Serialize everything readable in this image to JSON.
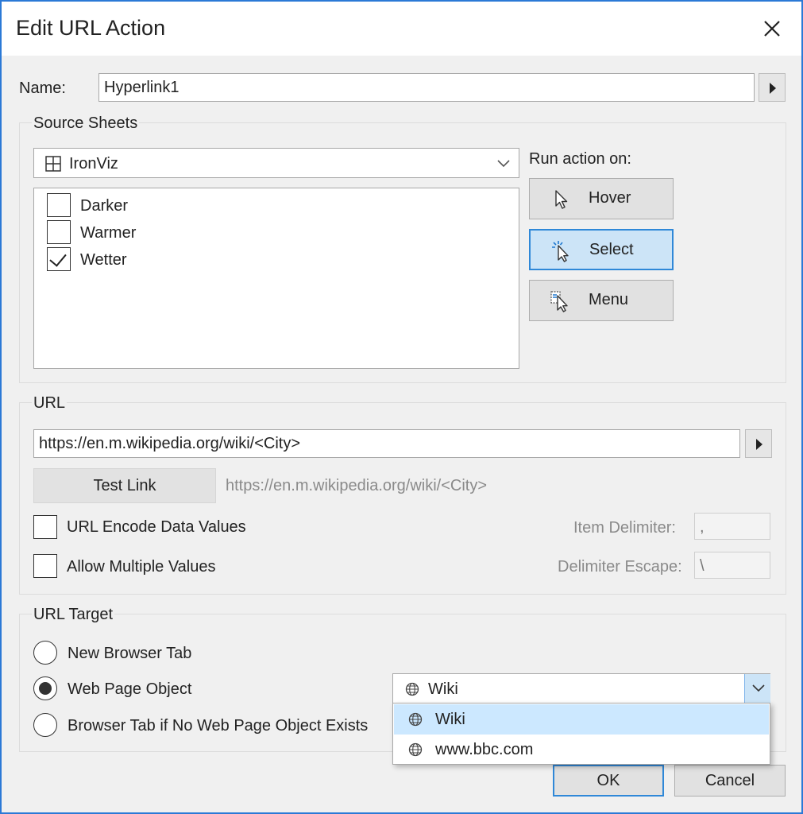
{
  "dialog": {
    "title": "Edit URL Action"
  },
  "name": {
    "label": "Name:",
    "value": "Hyperlink1"
  },
  "source_sheets": {
    "title": "Source Sheets",
    "dashboard": "IronViz",
    "sheets": [
      {
        "label": "Darker",
        "checked": false
      },
      {
        "label": "Warmer",
        "checked": false
      },
      {
        "label": "Wetter",
        "checked": true
      }
    ]
  },
  "run_action": {
    "label": "Run action on:",
    "options": [
      {
        "label": "Hover",
        "icon": "hover-cursor-icon",
        "active": false
      },
      {
        "label": "Select",
        "icon": "select-cursor-icon",
        "active": true
      },
      {
        "label": "Menu",
        "icon": "menu-cursor-icon",
        "active": false
      }
    ]
  },
  "url": {
    "title": "URL",
    "value": "https://en.m.wikipedia.org/wiki/<City>",
    "test_link_label": "Test Link",
    "preview": "https://en.m.wikipedia.org/wiki/<City>",
    "encode_label": "URL Encode Data Values",
    "encode_checked": false,
    "multiple_label": "Allow Multiple Values",
    "multiple_checked": false,
    "item_delimiter_label": "Item Delimiter:",
    "item_delimiter_value": ",",
    "delimiter_escape_label": "Delimiter Escape:",
    "delimiter_escape_value": "\\"
  },
  "url_target": {
    "title": "URL Target",
    "options": [
      {
        "label": "New Browser Tab",
        "selected": false
      },
      {
        "label": "Web Page Object",
        "selected": true
      },
      {
        "label": "Browser Tab if No Web Page Object Exists",
        "selected": false
      }
    ],
    "object_selected": "Wiki",
    "object_options": [
      "Wiki",
      "www.bbc.com"
    ]
  },
  "footer": {
    "ok_label": "OK",
    "cancel_label": "Cancel"
  },
  "colors": {
    "accent": "#2f88d8",
    "active_fill": "#cce4f7",
    "window_border": "#2b79d6"
  }
}
